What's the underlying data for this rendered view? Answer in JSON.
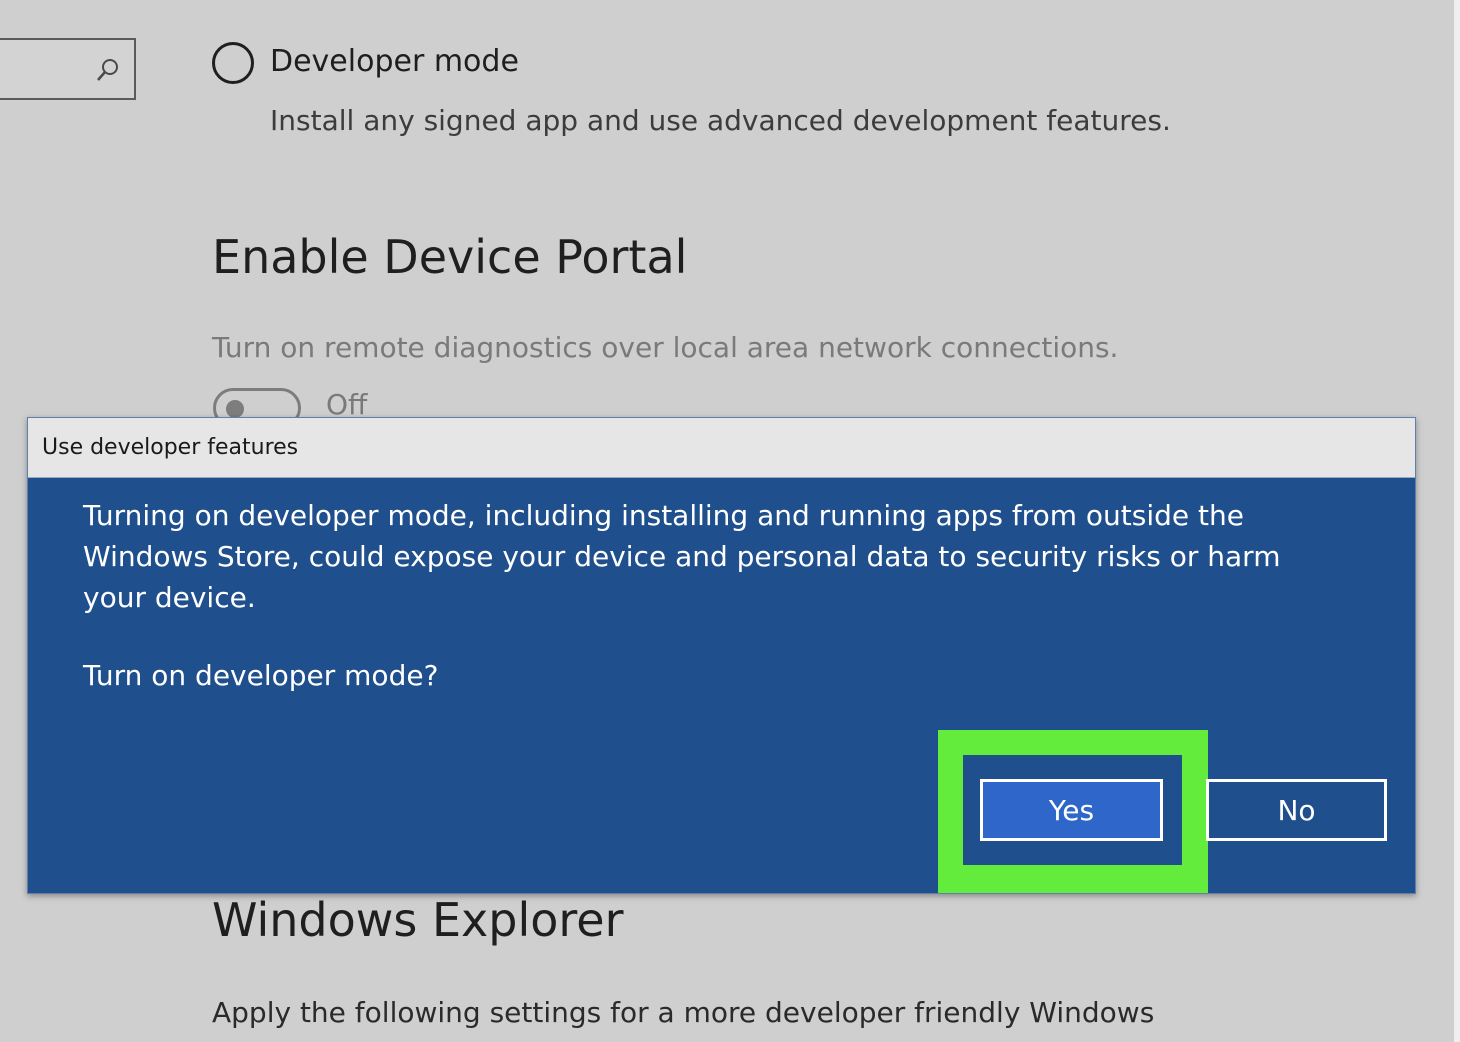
{
  "settings": {
    "developer_mode": {
      "label": "Developer mode",
      "description": "Install any signed app and use advanced development features."
    },
    "device_portal": {
      "title": "Enable Device Portal",
      "description": "Turn on remote diagnostics over local area network connections.",
      "toggle_state": "Off"
    },
    "windows_explorer": {
      "title": "Windows Explorer",
      "description": "Apply the following settings for a more developer friendly Windows"
    }
  },
  "dialog": {
    "title": "Use developer features",
    "message": "Turning on developer mode, including installing and running apps from outside the Windows Store, could expose your device and personal data to security risks or harm your device.",
    "question": "Turn on developer mode?",
    "yes_label": "Yes",
    "no_label": "No"
  },
  "colors": {
    "dialog_background": "#1f4f8d",
    "highlight": "#63ec3c",
    "yes_button": "#2f66c9"
  }
}
